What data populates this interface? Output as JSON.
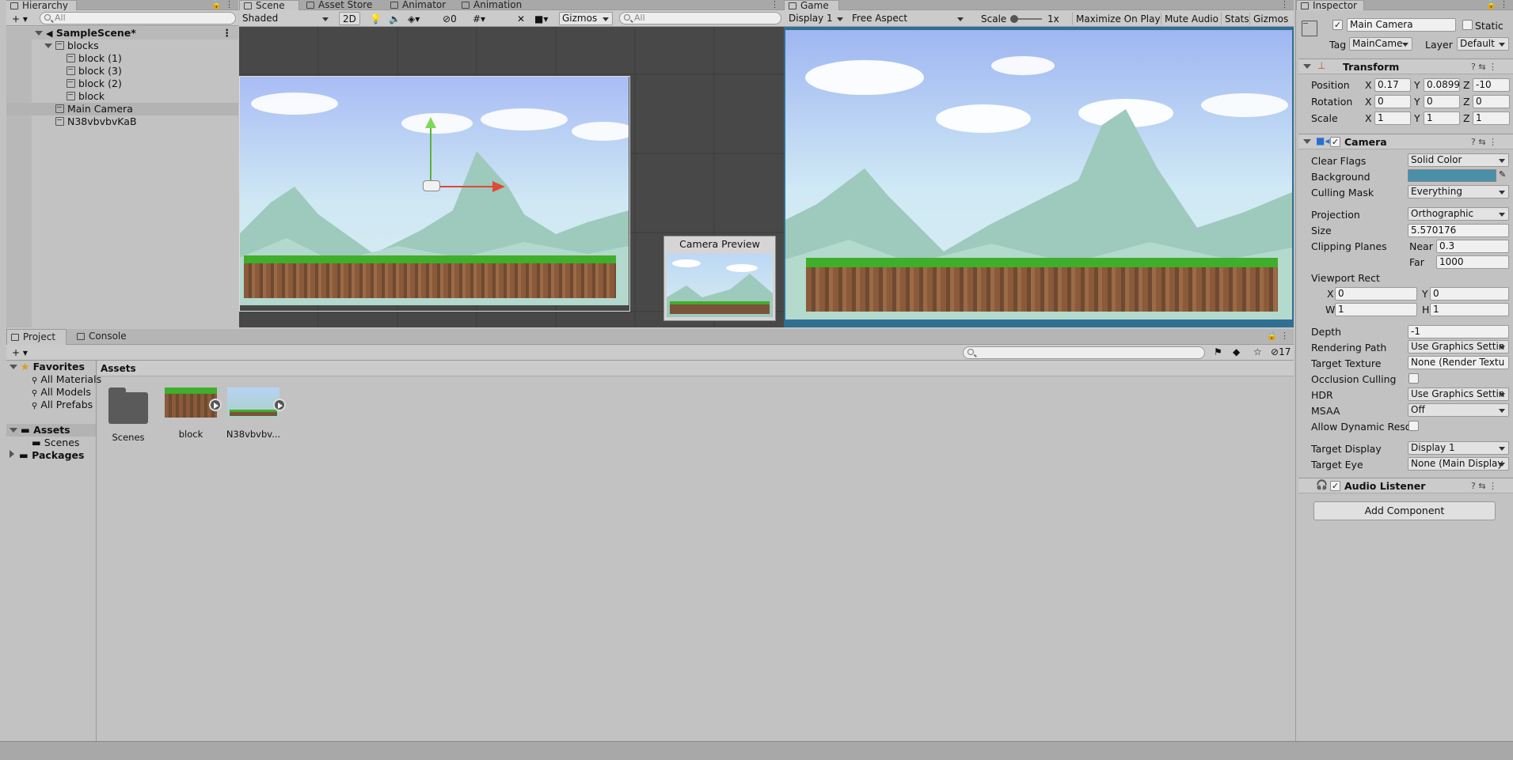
{
  "hierarchy": {
    "tab": "Hierarchy",
    "search_placeholder": "All",
    "scene_name": "SampleScene*",
    "items": [
      {
        "label": "blocks"
      },
      {
        "label": "block (1)"
      },
      {
        "label": "block (3)"
      },
      {
        "label": "block (2)"
      },
      {
        "label": "block"
      },
      {
        "label": "Main Camera"
      },
      {
        "label": "N38vbvbvKaB"
      }
    ]
  },
  "scene": {
    "tabs": [
      "Scene",
      "Asset Store",
      "Animator",
      "Animation"
    ],
    "shading": "Shaded",
    "mode_2d": "2D",
    "hidden_count": "0",
    "gizmos": "Gizmos",
    "search_placeholder": "All",
    "camera_preview_title": "Camera Preview"
  },
  "game": {
    "tab": "Game",
    "display": "Display 1",
    "aspect": "Free Aspect",
    "scale_label": "Scale",
    "scale_value": "1x",
    "maximize": "Maximize On Play",
    "mute": "Mute Audio",
    "stats": "Stats",
    "gizmos": "Gizmos"
  },
  "project": {
    "tabs": [
      "Project",
      "Console"
    ],
    "favorites_label": "Favorites",
    "favorites": [
      "All Materials",
      "All Models",
      "All Prefabs"
    ],
    "assets_label": "Assets",
    "assets_children": [
      "Scenes"
    ],
    "packages_label": "Packages",
    "breadcrumb": "Assets",
    "hidden_count": "17",
    "assets": [
      {
        "label": "Scenes",
        "kind": "folder-icon"
      },
      {
        "label": "block",
        "kind": "grass-block-icon"
      },
      {
        "label": "N38vbvbv...",
        "kind": "background-icon"
      }
    ]
  },
  "inspector": {
    "tab": "Inspector",
    "object_name": "Main Camera",
    "static_label": "Static",
    "tag_label": "Tag",
    "tag_value": "MainCame",
    "layer_label": "Layer",
    "layer_value": "Default",
    "transform": {
      "title": "Transform",
      "rows": [
        {
          "label": "Position",
          "x": "0.17",
          "y": "0.0899",
          "z": "-10"
        },
        {
          "label": "Rotation",
          "x": "0",
          "y": "0",
          "z": "0"
        },
        {
          "label": "Scale",
          "x": "1",
          "y": "1",
          "z": "1"
        }
      ]
    },
    "camera": {
      "title": "Camera",
      "clear_flags_label": "Clear Flags",
      "clear_flags": "Solid Color",
      "background_label": "Background",
      "background_color": "#4a8fa8",
      "culling_mask_label": "Culling Mask",
      "culling_mask": "Everything",
      "projection_label": "Projection",
      "projection": "Orthographic",
      "size_label": "Size",
      "size": "5.570176",
      "clipping_label": "Clipping Planes",
      "near_label": "Near",
      "near": "0.3",
      "far_label": "Far",
      "far": "1000",
      "viewport_label": "Viewport Rect",
      "vx": "0",
      "vy": "0",
      "vw": "1",
      "vh": "1",
      "depth_label": "Depth",
      "depth": "-1",
      "rendering_path_label": "Rendering Path",
      "rendering_path": "Use Graphics Settin",
      "target_texture_label": "Target Texture",
      "target_texture": "None (Render Textu",
      "occlusion_label": "Occlusion Culling",
      "hdr_label": "HDR",
      "hdr": "Use Graphics Settin",
      "msaa_label": "MSAA",
      "msaa": "Off",
      "dyn_res_label": "Allow Dynamic Resol",
      "target_display_label": "Target Display",
      "target_display": "Display 1",
      "target_eye_label": "Target Eye",
      "target_eye": "None (Main Display"
    },
    "audio_listener": {
      "title": "Audio Listener"
    },
    "add_component": "Add Component"
  }
}
